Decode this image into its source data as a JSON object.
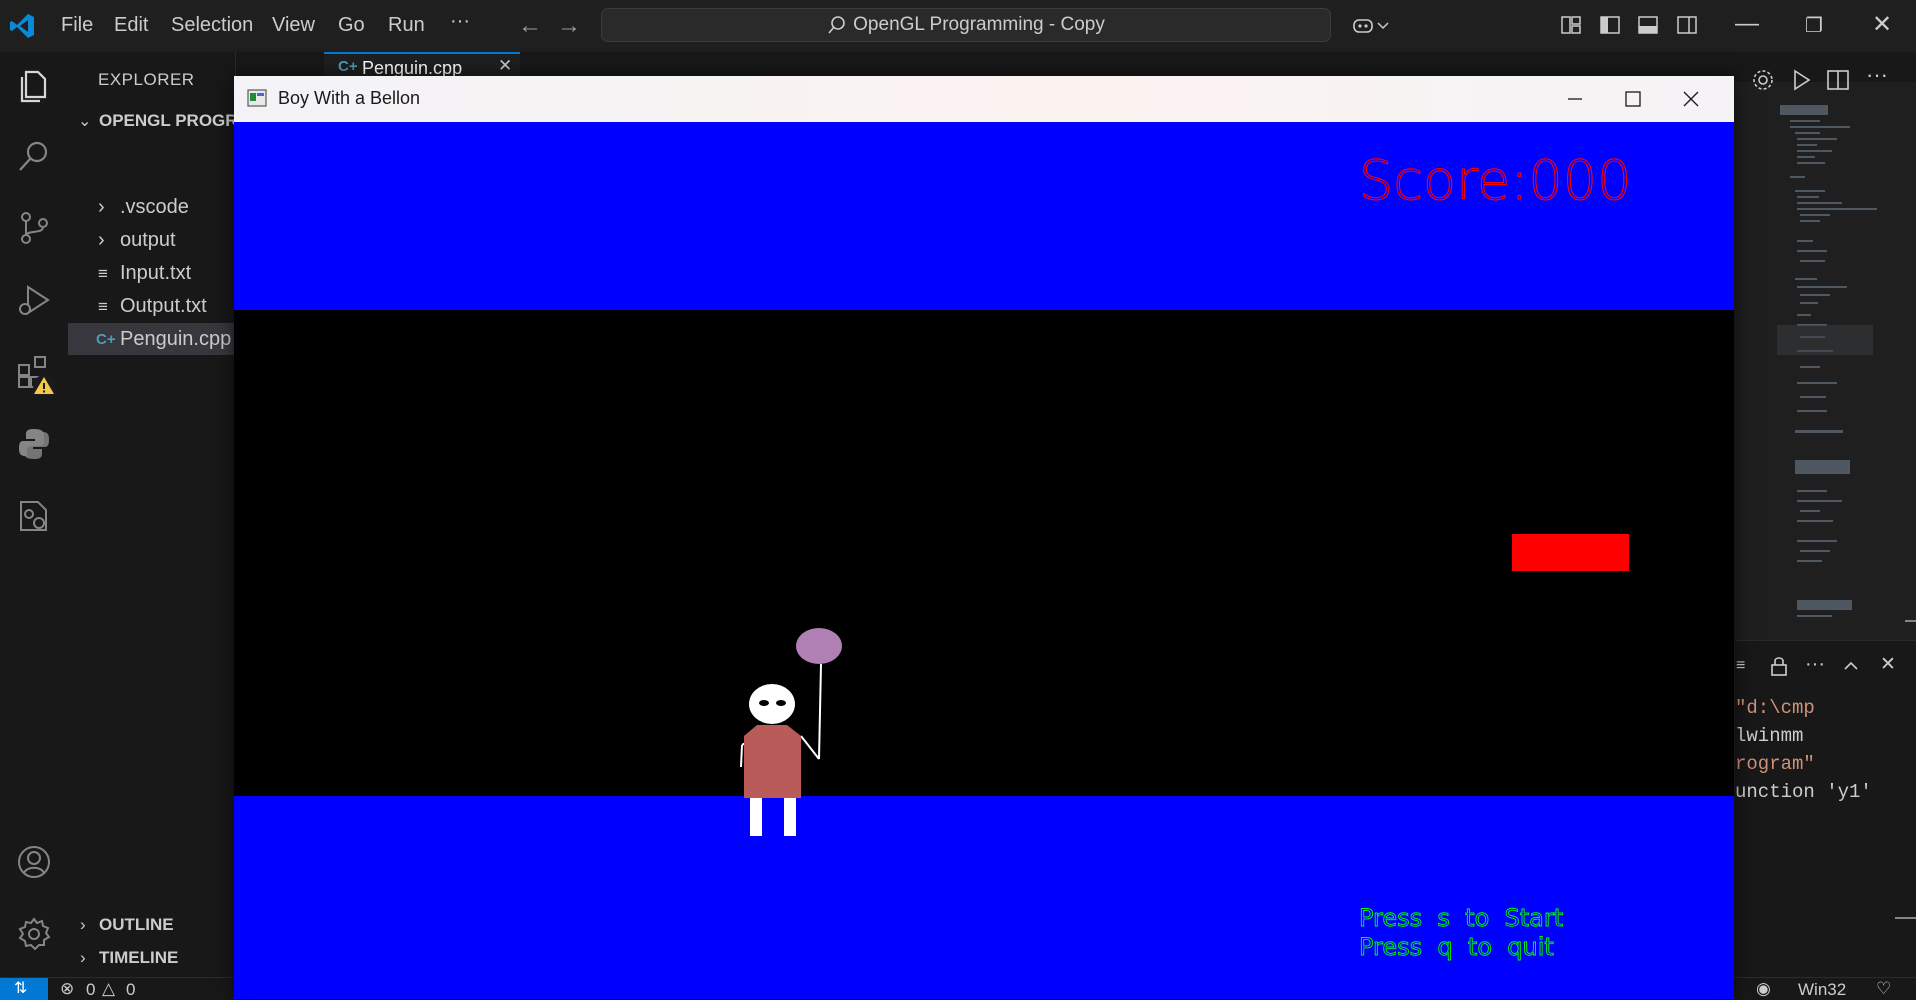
{
  "menu": [
    "File",
    "Edit",
    "Selection",
    "View",
    "Go",
    "Run",
    "···"
  ],
  "search": {
    "text": "OpenGL Programming - Copy"
  },
  "explorer": {
    "title": "EXPLORER",
    "project": "OPENGL PROGRA",
    "items": [
      {
        "label": ".vscode",
        "kind": "folder"
      },
      {
        "label": "output",
        "kind": "folder"
      },
      {
        "label": "Input.txt",
        "kind": "file"
      },
      {
        "label": "Output.txt",
        "kind": "file"
      },
      {
        "label": "Penguin.cpp",
        "kind": "cpp",
        "selected": true
      }
    ],
    "outline": "OUTLINE",
    "timeline": "TIMELINE"
  },
  "editor_tab": {
    "label": "Penguin.cpp"
  },
  "panel": {
    "lines": [
      {
        "text": " \"d:\\cmp",
        "color": "#ce9178"
      },
      {
        "text": "lwinmm",
        "color": "#cccccc"
      },
      {
        "text": "rogram\"",
        "color": "#ce9178"
      },
      {
        "text": "unction 'y1'",
        "color": "#cccccc"
      }
    ]
  },
  "status": {
    "errors": "0",
    "warnings": "0",
    "platform": "Win32"
  },
  "gl_window": {
    "title": "Boy With a Bellon",
    "colors": {
      "sky": "#0000ff",
      "ground": "#0000ff",
      "night": "#000000",
      "obstacle": "#ff0000",
      "score": "#ff0000",
      "hint": "#00ff00",
      "balloon": "#b07fb3",
      "shirt": "#b95c59"
    },
    "score_text": "Score:000",
    "hint_start": "Press  s  to  Start",
    "hint_quit": "Press  q  to  quit"
  }
}
